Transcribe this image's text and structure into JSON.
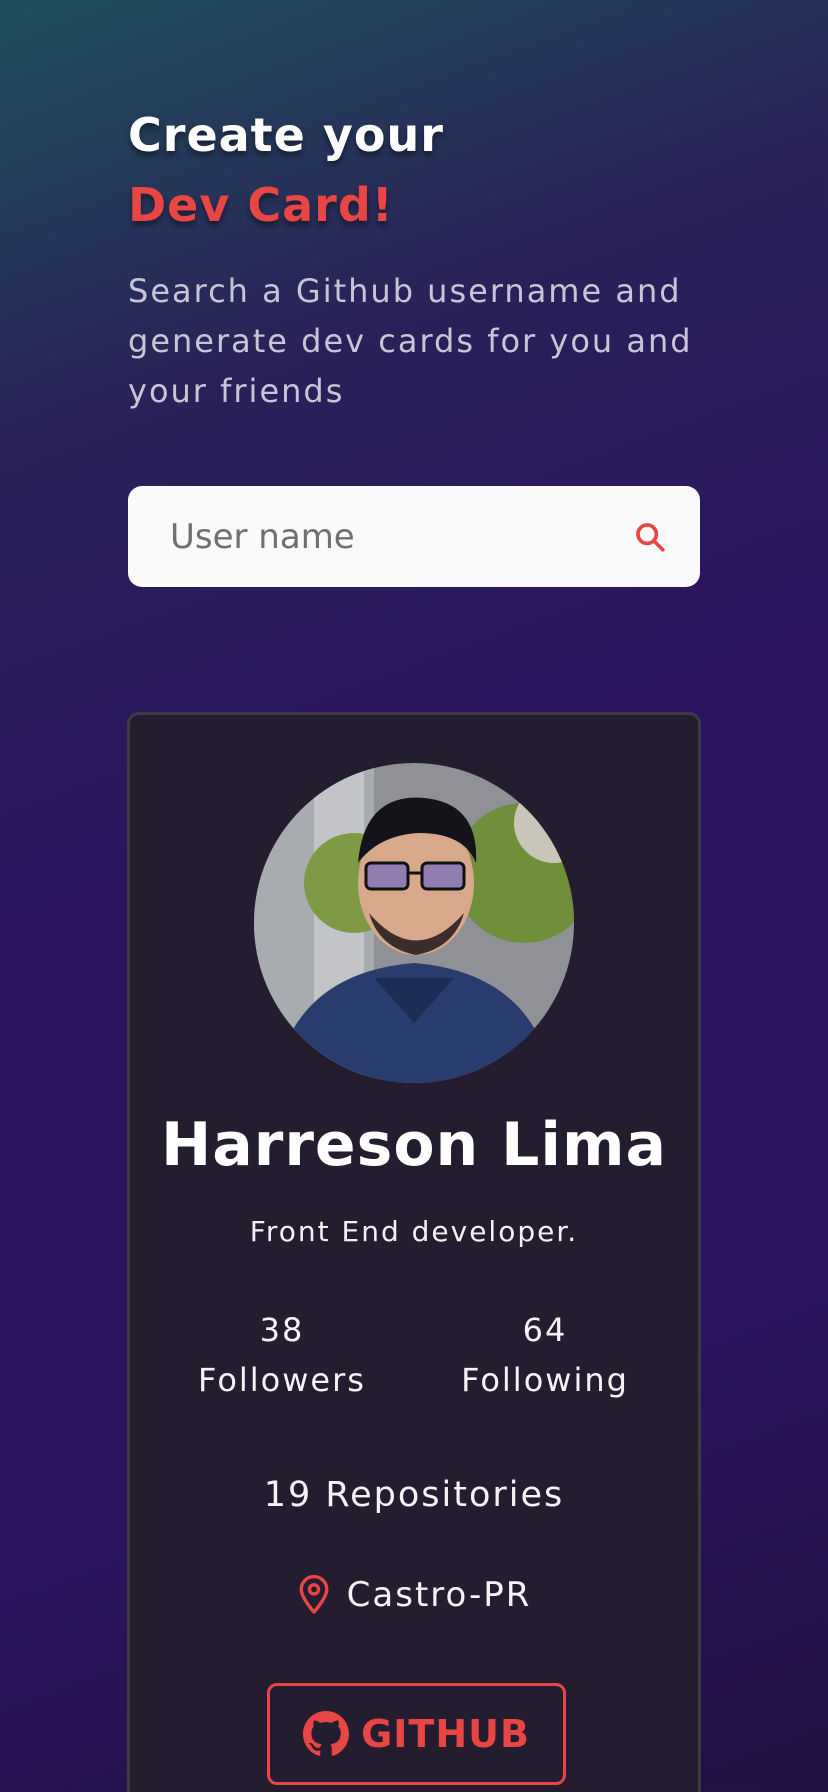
{
  "hero": {
    "title_line1": "Create your",
    "title_line2": "Dev Card!",
    "subtitle": "Search a Github username and generate dev cards for you and your friends"
  },
  "search": {
    "placeholder": "User name",
    "icon": "search-icon"
  },
  "card": {
    "avatar_alt": "profile photo",
    "name": "Harreson Lima",
    "bio": "Front End developer.",
    "followers": {
      "count": "38",
      "label": "Followers"
    },
    "following": {
      "count": "64",
      "label": "Following"
    },
    "repositories": "19 Repositories",
    "location": "Castro-PR",
    "github_button": "GITHUB"
  },
  "colors": {
    "accent": "#e84545",
    "card_bg": "#241c2f",
    "page_bg": "#2c1460"
  }
}
